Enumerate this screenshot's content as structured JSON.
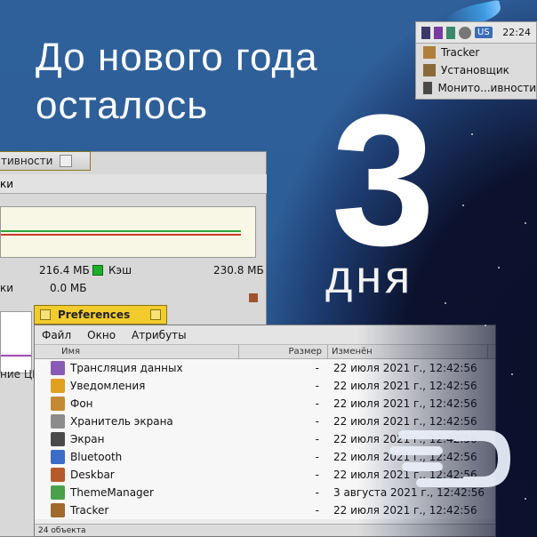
{
  "headline": {
    "line1": "До нового года",
    "line2": "осталось"
  },
  "countdown": {
    "number": "3",
    "unit": "дня"
  },
  "deskbar": {
    "keyboard_layout": "US",
    "clock": "22:24",
    "items": [
      "Tracker",
      "Установщик",
      "Монито...ивности"
    ]
  },
  "activity_monitor": {
    "tab_title": "тивности",
    "menu_fragment": "ки",
    "stats": [
      {
        "value": "216.4 МБ",
        "label": "Кэш",
        "value2": "230.8 МБ"
      },
      {
        "label_fragment": "ки",
        "value": "0.0 МБ"
      }
    ],
    "cpu_label": "ние ЦП"
  },
  "preferences": {
    "title": "Preferences",
    "menu": [
      "Файл",
      "Окно",
      "Атрибуты"
    ],
    "columns": {
      "name": "Имя",
      "size": "Размер",
      "modified": "Изменён"
    },
    "rows": [
      {
        "name": "Трансляция данных",
        "size": "-",
        "modified": "22 июля 2021 г., 12:42:56",
        "icon": "data-translation-icon",
        "color": "#8a5ab8"
      },
      {
        "name": "Уведомления",
        "size": "-",
        "modified": "22 июля 2021 г., 12:42:56",
        "icon": "notifications-icon",
        "color": "#e0a020"
      },
      {
        "name": "Фон",
        "size": "-",
        "modified": "22 июля 2021 г., 12:42:56",
        "icon": "background-icon",
        "color": "#c48a32"
      },
      {
        "name": "Хранитель экрана",
        "size": "-",
        "modified": "22 июля 2021 г., 12:42:56",
        "icon": "screensaver-icon",
        "color": "#8c8c8c"
      },
      {
        "name": "Экран",
        "size": "-",
        "modified": "22 июля 2021 г., 12:42:56",
        "icon": "screen-icon",
        "color": "#4a4a4a"
      },
      {
        "name": "Bluetooth",
        "size": "-",
        "modified": "22 июля 2021 г., 12:42:56",
        "icon": "bluetooth-icon",
        "color": "#3a6cc8"
      },
      {
        "name": "Deskbar",
        "size": "-",
        "modified": "22 июля 2021 г., 12:42:56",
        "icon": "deskbar-icon",
        "color": "#b55a2a"
      },
      {
        "name": "ThemeManager",
        "size": "-",
        "modified": "3 августа 2021 г., 12:42:56",
        "icon": "theme-manager-icon",
        "color": "#4ba04a"
      },
      {
        "name": "Tracker",
        "size": "-",
        "modified": "22 июля 2021 г., 12:42:56",
        "icon": "tracker-icon",
        "color": "#a06a2a"
      }
    ],
    "status": "24 объекта"
  },
  "colors": {
    "accent_yellow": "#f2cc2c",
    "desktop_blue": "#2d5f97",
    "graph_green": "#1fae2c"
  }
}
